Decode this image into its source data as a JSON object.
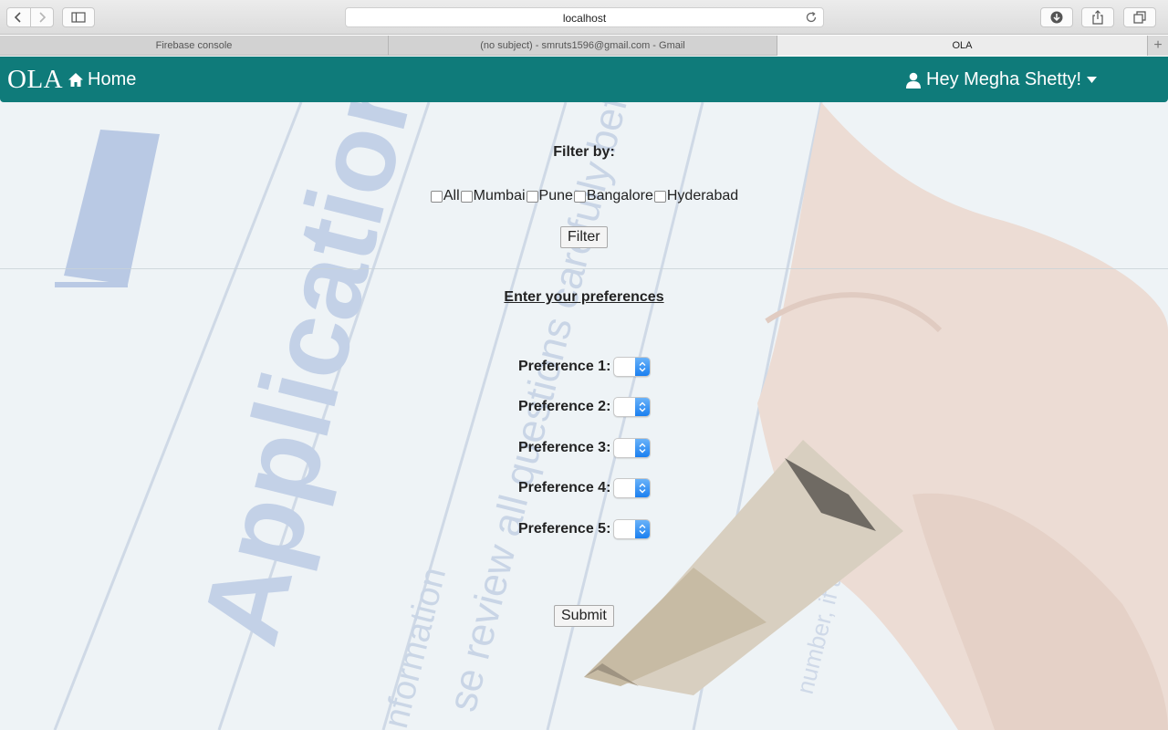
{
  "browser": {
    "url": "localhost",
    "tabs": [
      {
        "label": "Firebase console",
        "active": false
      },
      {
        "label": "(no subject) - smruts1596@gmail.com - Gmail",
        "active": false
      },
      {
        "label": "OLA",
        "active": true
      }
    ],
    "new_tab_symbol": "+"
  },
  "navbar": {
    "brand": "OLA",
    "home_label": "Home",
    "user_label": "Hey Megha Shetty!",
    "bg_color": "#0f7b7a"
  },
  "filter": {
    "title": "Filter by:",
    "options": [
      "All",
      "Mumbai",
      "Pune",
      "Bangalore",
      "Hyderabad"
    ],
    "button_label": "Filter"
  },
  "preferences": {
    "title": "Enter your preferences",
    "rows": [
      {
        "label": "Preference 1:"
      },
      {
        "label": "Preference 2:"
      },
      {
        "label": "Preference 3:"
      },
      {
        "label": "Preference 4:"
      },
      {
        "label": "Preference 5:"
      }
    ],
    "submit_label": "Submit"
  },
  "background": {
    "watermark_words": [
      "Application",
      "questions carefully before",
      "se review all",
      "nformation",
      "number, if any)"
    ]
  }
}
